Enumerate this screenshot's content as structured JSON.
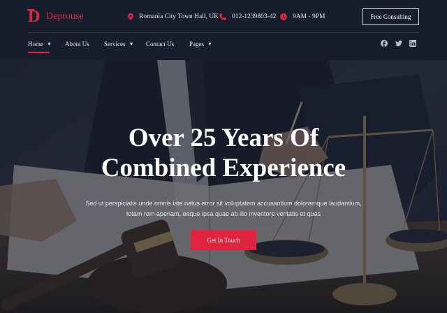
{
  "brand": {
    "logo_letter": "D",
    "name": "Deprouse",
    "accent": "#e0233f"
  },
  "topbar": {
    "address": {
      "icon": "map-pin-icon",
      "text": "Romania City Town Hall, UK"
    },
    "phone": {
      "icon": "phone-icon",
      "text": "012-1239803-42"
    },
    "hours": {
      "icon": "clock-icon",
      "text": "9AM - 9PM"
    },
    "cta_label": "Free Consulting"
  },
  "nav": {
    "items": [
      {
        "label": "Home",
        "dropdown": true,
        "active": true
      },
      {
        "label": "About Us",
        "dropdown": false
      },
      {
        "label": "Services",
        "dropdown": true
      },
      {
        "label": "Contact Us",
        "dropdown": false
      },
      {
        "label": "Pages",
        "dropdown": true
      }
    ],
    "chevron": "▼"
  },
  "social": [
    "facebook-icon",
    "twitter-icon",
    "linkedin-icon"
  ],
  "hero": {
    "title_line1": "Over 25 Years Of",
    "title_line2": "Combined Experience",
    "description": "Sed ut perspiciatis unde omnis iste natus error sit voluptatem accusantium doloremque laudantium, totam rem aperiam, eaque ipsa quae ab illo inventore veritatis et quas",
    "button_label": "Get In Touch"
  }
}
